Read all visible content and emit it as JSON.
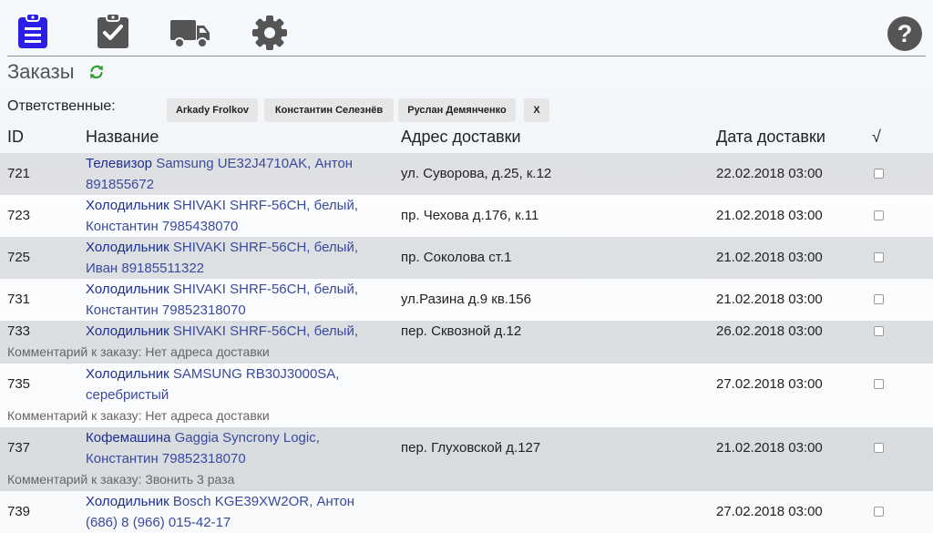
{
  "colors": {
    "accent": "#2b1ee6",
    "icon_gray": "#555555",
    "link": "#3a4a9e",
    "refresh": "#2e9e2e"
  },
  "toolbar": {
    "icons": [
      "clipboard-list-icon",
      "clipboard-check-icon",
      "truck-icon",
      "gear-icon",
      "help-icon"
    ],
    "help_label": "?"
  },
  "page": {
    "title": "Заказы"
  },
  "responsible": {
    "label": "Ответственные:",
    "chips": [
      "Arkady Frolkov",
      "Константин Селезнёв",
      "Руслан Демянченко",
      "X"
    ]
  },
  "table": {
    "headers": {
      "id": "ID",
      "name": "Название",
      "address": "Адрес доставки",
      "date": "Дата доставки",
      "check": "√"
    },
    "comment_prefix": "Комментарий к заказу: ",
    "rows": [
      {
        "id": "721",
        "product_type": "Телевизор",
        "name_rest": "Samsung UE32J4710AK, Антон 891855672",
        "address": "ул. Суворова, д.25, к.12",
        "date": "22.02.2018 03:00",
        "comment": ""
      },
      {
        "id": "723",
        "product_type": "Холодильник",
        "name_rest": "SHIVAKI SHRF-56CH, белый, Константин 7985438070",
        "address": "пр. Чехова д.176, к.11",
        "date": "21.02.2018 03:00",
        "comment": ""
      },
      {
        "id": "725",
        "product_type": "Холодильник",
        "name_rest": "SHIVAKI SHRF-56CH, белый, Иван 89185511322",
        "address": "пр. Соколова ст.1",
        "date": "21.02.2018 03:00",
        "comment": ""
      },
      {
        "id": "731",
        "product_type": "Холодильник",
        "name_rest": "SHIVAKI SHRF-56CH, белый, Константин 79852318070",
        "address": "ул.Разина д.9 кв.156",
        "date": "21.02.2018 03:00",
        "comment": ""
      },
      {
        "id": "733",
        "product_type": "Холодильник",
        "name_rest": "SHIVAKI SHRF-56CH, белый,",
        "address": "пер. Сквозной д.12",
        "date": "26.02.2018 03:00",
        "comment": "Нет адреса доставки"
      },
      {
        "id": "735",
        "product_type": "Холодильник",
        "name_rest": "SAMSUNG RB30J3000SA, серебристый",
        "address": "",
        "date": "27.02.2018 03:00",
        "comment": "Нет адреса доставки"
      },
      {
        "id": "737",
        "product_type": "Кофемашина",
        "name_rest": "Gaggia Syncrony Logic, Константин 79852318070",
        "address": "пер. Глуховской д.127",
        "date": "21.02.2018 03:00",
        "comment": "Звонить 3 раза"
      },
      {
        "id": "739",
        "product_type": "Холодильник",
        "name_rest": "Bosch KGE39XW2OR, Антон (686) 8 (966) 015-42-17",
        "address": "",
        "date": "27.02.2018 03:00",
        "comment": ""
      }
    ]
  }
}
